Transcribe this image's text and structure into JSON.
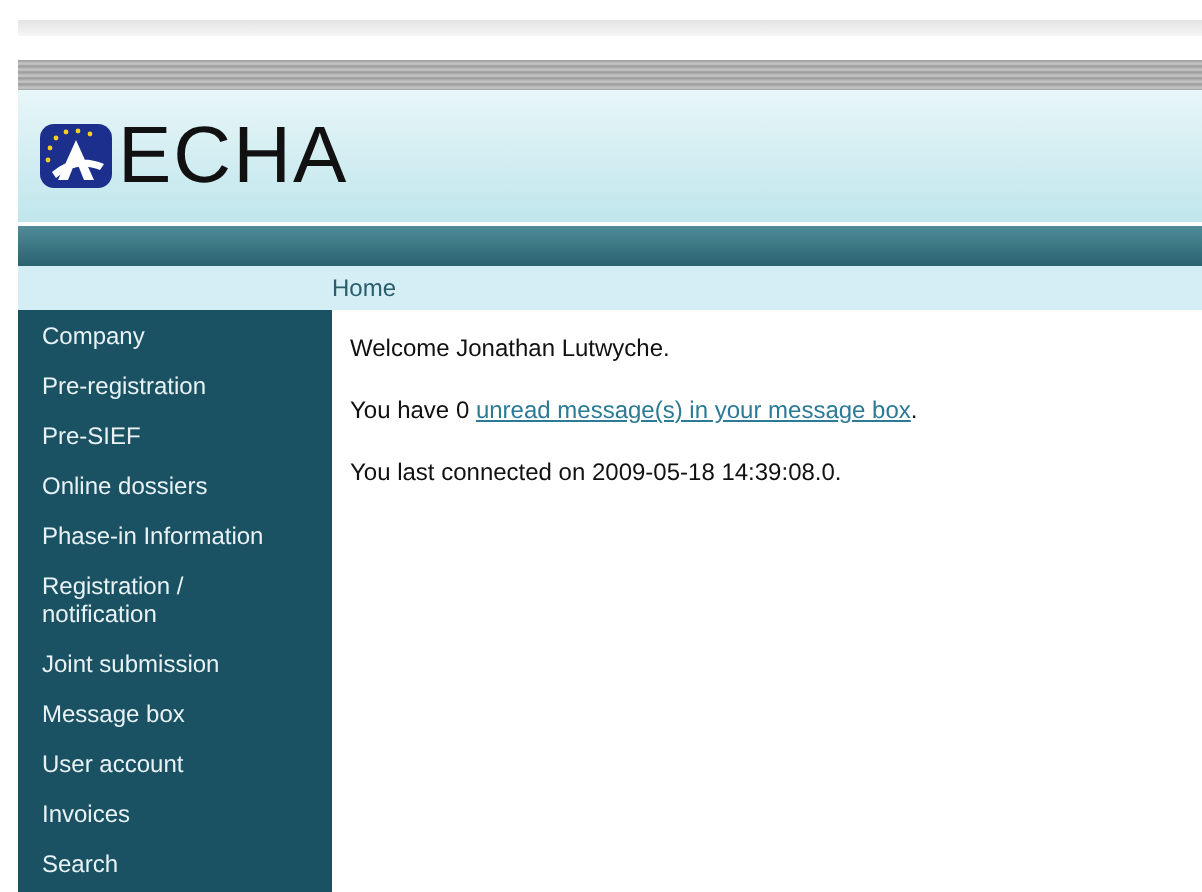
{
  "header": {
    "logo_text": "ECHA"
  },
  "breadcrumb": "Home",
  "sidebar": {
    "items": [
      {
        "label": "Company"
      },
      {
        "label": "Pre-registration"
      },
      {
        "label": "Pre-SIEF"
      },
      {
        "label": "Online dossiers"
      },
      {
        "label": "Phase-in Information"
      },
      {
        "label": "Registration / notification"
      },
      {
        "label": "Joint submission"
      },
      {
        "label": "Message box"
      },
      {
        "label": "User account"
      },
      {
        "label": "Invoices"
      },
      {
        "label": "Search"
      }
    ]
  },
  "content": {
    "welcome": "Welcome Jonathan Lutwyche.",
    "messages": {
      "before": "You have 0 ",
      "link": "unread message(s) in your message box",
      "after": "."
    },
    "last_connected": "You last connected on 2009-05-18 14:39:08.0."
  }
}
